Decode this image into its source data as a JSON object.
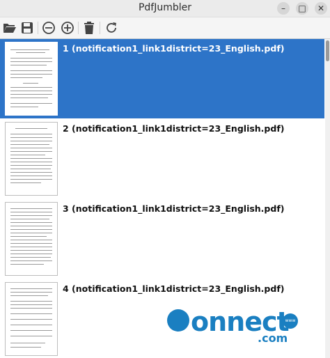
{
  "window": {
    "title": "PdfJumbler",
    "minimize": "–",
    "maximize": "□",
    "close": "✕"
  },
  "toolbar": {
    "open_icon": "folder-open-icon",
    "save_icon": "save-icon",
    "zoom_out_icon": "zoom-out-icon",
    "zoom_in_icon": "zoom-in-icon",
    "delete_icon": "trash-icon",
    "rotate_icon": "rotate-icon"
  },
  "pages": [
    {
      "label": "1 (notification1_link1district=23_English.pdf)",
      "selected": true
    },
    {
      "label": "2 (notification1_link1district=23_English.pdf)",
      "selected": false
    },
    {
      "label": "3 (notification1_link1district=23_English.pdf)",
      "selected": false
    },
    {
      "label": "4 (notification1_link1district=23_English.pdf)",
      "selected": false
    }
  ],
  "watermark": {
    "main": "onnect",
    "suffix": ".com",
    "badge": "www"
  },
  "colors": {
    "selection": "#2d74c8",
    "watermark": "#1a7fc1"
  }
}
